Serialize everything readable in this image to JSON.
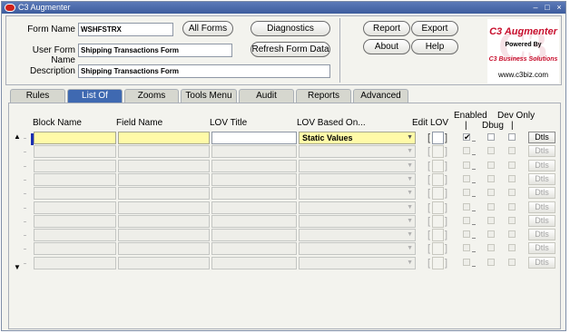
{
  "window": {
    "title": "C3 Augmenter"
  },
  "header": {
    "form_name_label": "Form Name",
    "form_name_value": "WSHFSTRX",
    "user_form_name_label": "User Form Name",
    "user_form_name_value": "Shipping Transactions Form",
    "description_label": "Description",
    "description_value": "Shipping Transactions Form",
    "buttons": {
      "all_forms": "All Forms",
      "diagnostics": "Diagnostics",
      "refresh_form_data": "Refresh Form Data",
      "report": "Report",
      "export": "Export",
      "about": "About",
      "help": "Help"
    },
    "logo": {
      "title": "C3 Augmenter",
      "powered_by": "Powered By",
      "company": "C3 Business Solutions",
      "website": "www.c3biz.com"
    }
  },
  "tabs": [
    "Rules",
    "List Of Values",
    "Zooms",
    "Tools Menu",
    "Audit",
    "Reports",
    "Advanced"
  ],
  "active_tab": "List Of Values",
  "grid": {
    "headers": {
      "block_name": "Block Name",
      "field_name": "Field Name",
      "lov_title": "LOV Title",
      "lov_based_on": "LOV Based On...",
      "edit_lov": "Edit LOV",
      "enabled": "Enabled",
      "dev_only": "Dev Only",
      "dbug": "Dbug",
      "pipe": "|"
    },
    "bracket_open": "[",
    "bracket_close": "]",
    "details_label": "Dtls",
    "rows": [
      {
        "block_name": "",
        "field_name": "",
        "lov_title": "",
        "lov_based_on": "Static Values",
        "enabled": true,
        "dbug": false,
        "dev_only": false,
        "active": true
      },
      {
        "block_name": "",
        "field_name": "",
        "lov_title": "",
        "lov_based_on": "",
        "enabled": false,
        "dbug": false,
        "dev_only": false,
        "active": false
      },
      {
        "block_name": "",
        "field_name": "",
        "lov_title": "",
        "lov_based_on": "",
        "enabled": false,
        "dbug": false,
        "dev_only": false,
        "active": false
      },
      {
        "block_name": "",
        "field_name": "",
        "lov_title": "",
        "lov_based_on": "",
        "enabled": false,
        "dbug": false,
        "dev_only": false,
        "active": false
      },
      {
        "block_name": "",
        "field_name": "",
        "lov_title": "",
        "lov_based_on": "",
        "enabled": false,
        "dbug": false,
        "dev_only": false,
        "active": false
      },
      {
        "block_name": "",
        "field_name": "",
        "lov_title": "",
        "lov_based_on": "",
        "enabled": false,
        "dbug": false,
        "dev_only": false,
        "active": false
      },
      {
        "block_name": "",
        "field_name": "",
        "lov_title": "",
        "lov_based_on": "",
        "enabled": false,
        "dbug": false,
        "dev_only": false,
        "active": false
      },
      {
        "block_name": "",
        "field_name": "",
        "lov_title": "",
        "lov_based_on": "",
        "enabled": false,
        "dbug": false,
        "dev_only": false,
        "active": false
      },
      {
        "block_name": "",
        "field_name": "",
        "lov_title": "",
        "lov_based_on": "",
        "enabled": false,
        "dbug": false,
        "dev_only": false,
        "active": false
      },
      {
        "block_name": "",
        "field_name": "",
        "lov_title": "",
        "lov_based_on": "",
        "enabled": false,
        "dbug": false,
        "dev_only": false,
        "active": false
      }
    ]
  },
  "icons": {
    "app": "oracle-app-icon",
    "minimize": "minimize-icon",
    "restore": "restore-icon",
    "close": "close-icon",
    "dropdown": "chevron-down-icon",
    "scroll_up": "scroll-up-icon",
    "scroll_down": "scroll-down-icon",
    "check": "checkmark-icon"
  },
  "colors": {
    "titlebar": "#3d5d9e",
    "active_tab": "#3f69b1",
    "current_field": "#fffaa8",
    "logo_red": "#c8102e"
  }
}
